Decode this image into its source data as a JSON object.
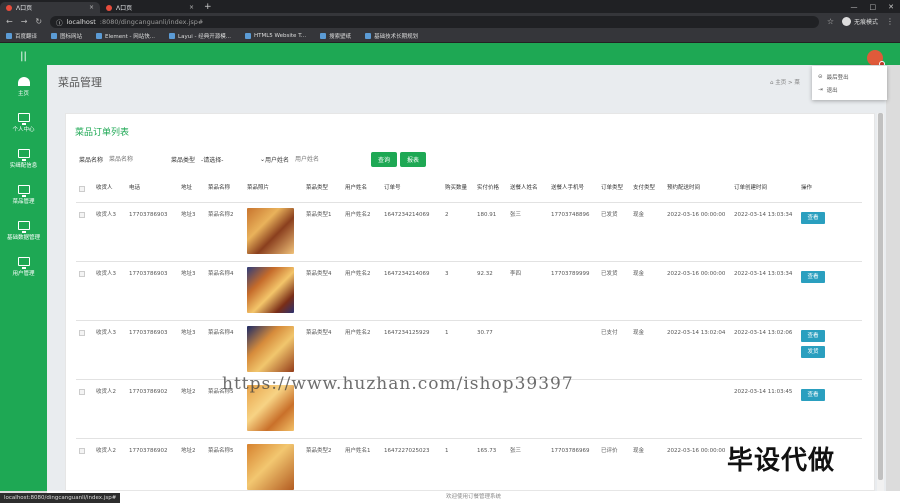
{
  "browser": {
    "tabs": [
      {
        "label": "Λ口页",
        "active": true
      },
      {
        "label": "Λ口页",
        "active": false
      }
    ],
    "url_host": "localhost",
    "url_path": ":8080/dingcanguanli/index.jsp#",
    "incognito_label": "无痕模式",
    "bookmarks": [
      "百度翻译",
      "图标网站",
      "Element - 网站快...",
      "Layui - 经典开源模...",
      "HTML5 Website T...",
      "搜索壁纸",
      "基础技术长期规划"
    ],
    "status_url": "localhost:8080/dingcanguanli/index.jsp#"
  },
  "sidebar": {
    "logo": "||",
    "items": [
      {
        "label": "主页",
        "icon": "dashboard-icon"
      },
      {
        "label": "个人中心",
        "icon": "monitor-icon"
      },
      {
        "label": "实缉配信息",
        "icon": "monitor-icon"
      },
      {
        "label": "菜品管理",
        "icon": "monitor-icon"
      },
      {
        "label": "基础数据管理",
        "icon": "monitor-icon"
      },
      {
        "label": "用户管理",
        "icon": "monitor-icon"
      }
    ]
  },
  "user_menu": {
    "items": [
      "最后登出",
      "退出"
    ]
  },
  "page": {
    "title": "菜品管理",
    "breadcrumb_home": "主页",
    "breadcrumb_sep": "> 菜"
  },
  "card": {
    "title": "菜品订单列表",
    "search": {
      "name_label": "菜品名称",
      "name_placeholder": "菜品名称",
      "type_label": "菜品类型",
      "type_value": "-请选择-",
      "user_label": "用户姓名",
      "user_placeholder": "用户姓名",
      "query_button": "查询",
      "report_button": "报表"
    },
    "columns": [
      "收货人",
      "电话",
      "地址",
      "菜品名称",
      "菜品照片",
      "菜品类型",
      "用户姓名",
      "订单号",
      "购买数量",
      "实付价格",
      "送餐人姓名",
      "送餐人手机号",
      "订单类型",
      "支付类型",
      "预约配送时间",
      "订单创建时间",
      "操作"
    ],
    "rows": [
      {
        "receiver": "收货人3",
        "phone": "17703786903",
        "address": "地址3",
        "dish": "菜品名称2",
        "image": "a",
        "type": "菜品类型1",
        "user": "用户姓名2",
        "order_no": "1647234214069",
        "qty": "2",
        "price": "180.91",
        "courier": "张三",
        "courier_phone": "17703748896",
        "status": "已发货",
        "pay": "现金",
        "booking": "2022-03-16 00:00:00",
        "created": "2022-03-14 13:03:34",
        "actions": [
          "查看"
        ]
      },
      {
        "receiver": "收货人3",
        "phone": "17703786903",
        "address": "地址3",
        "dish": "菜品名称4",
        "image": "b",
        "type": "菜品类型4",
        "user": "用户姓名2",
        "order_no": "1647234214069",
        "qty": "3",
        "price": "92.32",
        "courier": "李四",
        "courier_phone": "17703789999",
        "status": "已发货",
        "pay": "现金",
        "booking": "2022-03-16 00:00:00",
        "created": "2022-03-14 13:03:34",
        "actions": [
          "查看"
        ]
      },
      {
        "receiver": "收货人3",
        "phone": "17703786903",
        "address": "地址3",
        "dish": "菜品名称4",
        "image": "c",
        "type": "菜品类型4",
        "user": "用户姓名2",
        "order_no": "1647234125929",
        "qty": "1",
        "price": "30.77",
        "courier": "",
        "courier_phone": "",
        "status": "已支付",
        "pay": "现金",
        "booking": "2022-03-14 13:02:04",
        "created": "2022-03-14 13:02:06",
        "actions": [
          "查看",
          "发货"
        ]
      },
      {
        "receiver": "收货人2",
        "phone": "17703786902",
        "address": "地址2",
        "dish": "菜品名称5",
        "image": "d",
        "type": "",
        "user": "",
        "order_no": "",
        "qty": "",
        "price": "",
        "courier": "",
        "courier_phone": "",
        "status": "",
        "pay": "",
        "booking": "",
        "created": "2022-03-14 11:03:45",
        "actions": [
          "查看"
        ]
      },
      {
        "receiver": "收货人2",
        "phone": "17703786902",
        "address": "地址2",
        "dish": "菜品名称5",
        "image": "e",
        "type": "菜品类型2",
        "user": "用户姓名1",
        "order_no": "1647227025023",
        "qty": "1",
        "price": "165.73",
        "courier": "张三",
        "courier_phone": "17703786969",
        "status": "已评价",
        "pay": "现金",
        "booking": "2022-03-16 00:00:00",
        "created": "",
        "actions": []
      }
    ]
  },
  "footer": "欢迎使用订餐管理系统",
  "watermark": "https://www.huzhan.com/ishop39397",
  "watermark_cn": "毕设代做",
  "colors": {
    "brand": "#1ea854",
    "action": "#2a9fbf"
  }
}
